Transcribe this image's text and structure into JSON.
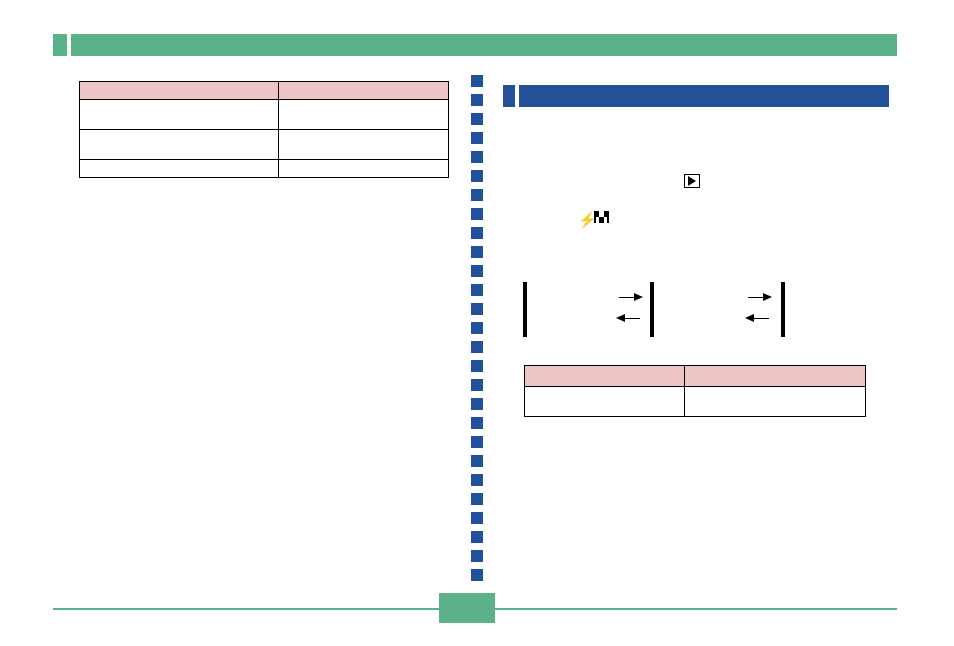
{
  "header": {
    "title": ""
  },
  "left_table": {
    "headers": [
      "",
      ""
    ],
    "rows": [
      [
        "",
        ""
      ],
      [
        "",
        ""
      ],
      [
        "",
        ""
      ]
    ]
  },
  "right_section": {
    "title": "",
    "playback_label": "",
    "flash_label": ""
  },
  "right_table": {
    "headers": [
      "",
      ""
    ],
    "rows": [
      [
        "",
        ""
      ]
    ]
  },
  "footer": {
    "page": ""
  }
}
